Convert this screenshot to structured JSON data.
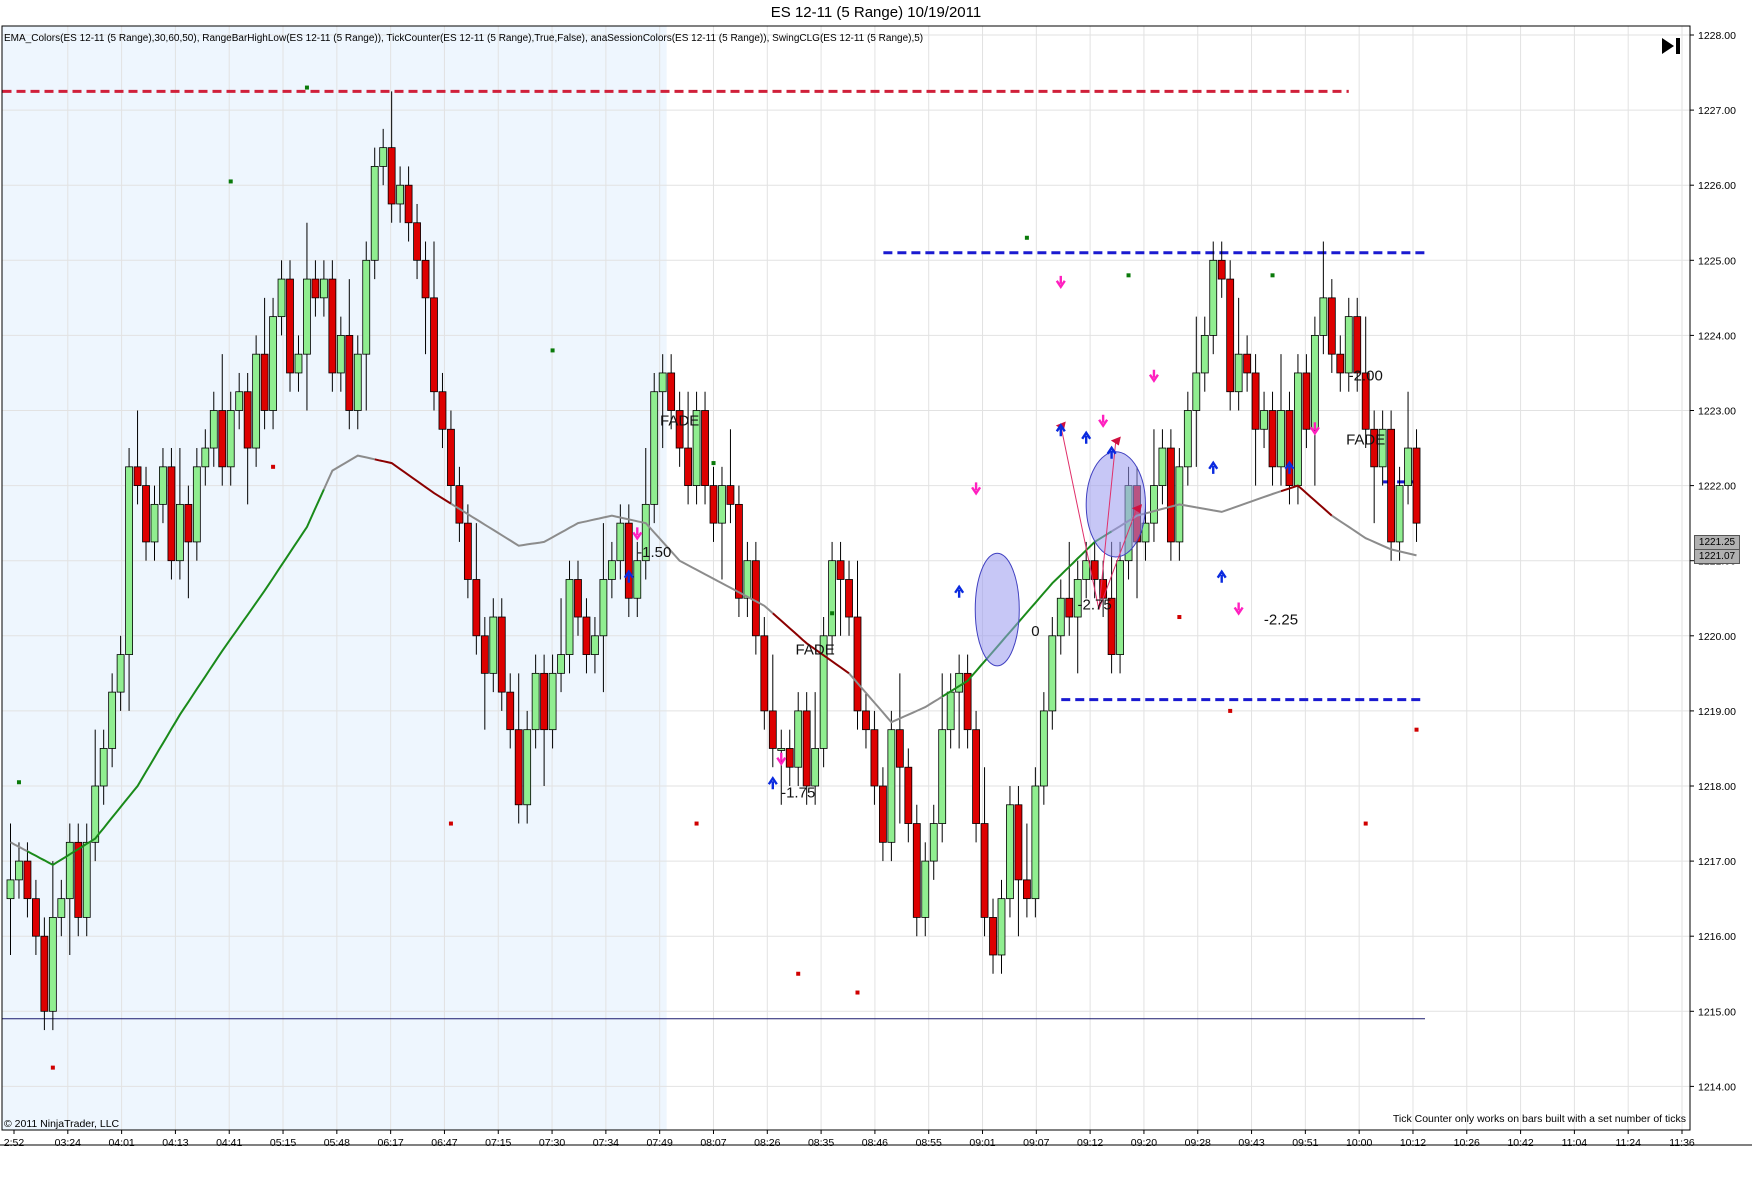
{
  "window": {
    "title": "ES 12-11 (5 Range)  10/19/2011",
    "indicators": "EMA_Colors(ES 12-11 (5 Range),30,60,50), RangeBarHighLow(ES 12-11 (5 Range)), TickCounter(ES 12-11 (5 Range),True,False), anaSessionColors(ES 12-11 (5 Range)), SwingCLG(ES 12-11 (5 Range),5)",
    "copyright": "© 2011 NinjaTrader, LLC",
    "tick_counter_note": "Tick Counter only works on bars built with a set number of ticks"
  },
  "colors": {
    "up_bar": "#90ee90",
    "down_bar": "#dd0000",
    "session_shade": "#eef6fe",
    "ema_up": "#1a8a1a",
    "ema_down": "#8b0000",
    "ema_flat": "#8c8c8c",
    "red_line": "#d0203a",
    "blue_line": "#1a1ad0",
    "circle_fill": "#9999ee"
  },
  "price_tags": [
    "1221.25",
    "1221.07"
  ],
  "chart_data": {
    "type": "candlestick",
    "title": "ES 12-11 (5 Range)  10/19/2011",
    "ylim": [
      1213.4,
      1228.2
    ],
    "y_ticks": [
      "1214.00",
      "1215.00",
      "1216.00",
      "1217.00",
      "1218.00",
      "1219.00",
      "1220.00",
      "1221.00",
      "1222.00",
      "1223.00",
      "1224.00",
      "1225.00",
      "1226.00",
      "1227.00",
      "1228.00"
    ],
    "x_ticks": [
      "2:52",
      "03:24",
      "04:01",
      "04:13",
      "04:41",
      "05:15",
      "05:48",
      "06:17",
      "06:47",
      "07:15",
      "07:30",
      "07:34",
      "07:49",
      "08:07",
      "08:26",
      "08:35",
      "08:46",
      "08:55",
      "09:01",
      "09:07",
      "09:12",
      "09:20",
      "09:28",
      "09:43",
      "09:51",
      "10:00",
      "10:12",
      "10:26",
      "10:42",
      "11:04",
      "11:24",
      "11:36"
    ],
    "bar_count": 167,
    "grid": true,
    "session_shading": {
      "from_bar": 0,
      "to_bar": 77
    },
    "opens": [
      1216.5,
      1216.75,
      1217.0,
      1216.5,
      1216.0,
      1215.0,
      1216.25,
      1216.5,
      1217.25,
      1216.25,
      1217.25,
      1218.0,
      1218.5,
      1219.25,
      1219.75,
      1222.25,
      1222.0,
      1221.25,
      1221.75,
      1222.25,
      1221.0,
      1221.75,
      1221.25,
      1222.25,
      1222.5,
      1223.0,
      1222.25,
      1223.0,
      1223.25,
      1222.5,
      1223.75,
      1223.0,
      1224.25,
      1224.75,
      1223.5,
      1223.75,
      1224.75,
      1224.5,
      1224.75,
      1223.5,
      1224.0,
      1223.0,
      1223.75,
      1225.0,
      1226.25,
      1226.5,
      1225.75,
      1226.0,
      1225.5,
      1225.0,
      1224.5,
      1223.25,
      1222.75,
      1222.0,
      1221.5,
      1220.75,
      1220.0,
      1219.5,
      1220.25,
      1219.25,
      1218.75,
      1217.75,
      1218.75,
      1219.5,
      1218.75,
      1219.5,
      1219.75,
      1220.75,
      1220.25,
      1219.75,
      1220.0,
      1220.75,
      1221.0,
      1221.5,
      1220.5,
      1221.0,
      1221.75,
      1223.25,
      1223.5,
      1223.0,
      1222.5,
      1222.0,
      1223.0,
      1222.0,
      1221.5,
      1222.0,
      1221.75,
      1220.5,
      1221.0,
      1220.0,
      1219.0,
      1218.5,
      1218.5,
      1218.25,
      1219.0,
      1218.0,
      1218.5,
      1220.0,
      1221.0,
      1220.75,
      1220.25,
      1219.0,
      1218.75,
      1218.0,
      1217.25,
      1218.75,
      1218.25,
      1217.5,
      1216.25,
      1217.0,
      1217.5,
      1218.75,
      1219.25,
      1219.5,
      1218.75,
      1217.5,
      1216.25,
      1215.75,
      1216.5,
      1217.75,
      1216.75,
      1216.5,
      1218.0,
      1219.0,
      1220.0,
      1220.5,
      1220.25,
      1220.75,
      1221.0,
      1220.75,
      1220.5,
      1219.75,
      1221.0,
      1222.0,
      1221.25,
      1221.5,
      1222.0,
      1222.5,
      1221.25,
      1222.25,
      1223.0,
      1223.5,
      1224.0,
      1225.0,
      1224.75,
      1223.25,
      1223.75,
      1223.5,
      1222.75,
      1223.0,
      1222.25,
      1223.0,
      1222.0,
      1223.5,
      1222.75,
      1224.0,
      1224.5,
      1223.75,
      1223.5,
      1224.25,
      1223.5,
      1222.75,
      1222.25,
      1222.75,
      1221.25,
      1222.0,
      1222.5,
      1221.5,
      1220.75
    ],
    "closes": [
      1216.75,
      1217.0,
      1216.5,
      1216.0,
      1215.0,
      1216.25,
      1216.5,
      1217.25,
      1216.25,
      1217.25,
      1218.0,
      1218.5,
      1219.25,
      1219.75,
      1222.25,
      1222.0,
      1221.25,
      1221.75,
      1222.25,
      1221.0,
      1221.75,
      1221.25,
      1222.25,
      1222.5,
      1223.0,
      1222.25,
      1223.0,
      1223.25,
      1222.5,
      1223.75,
      1223.0,
      1224.25,
      1224.75,
      1223.5,
      1223.75,
      1224.75,
      1224.5,
      1224.75,
      1223.5,
      1224.0,
      1223.0,
      1223.75,
      1225.0,
      1226.25,
      1226.5,
      1225.75,
      1226.0,
      1225.5,
      1225.0,
      1224.5,
      1223.25,
      1222.75,
      1222.0,
      1221.5,
      1220.75,
      1220.0,
      1219.5,
      1220.25,
      1219.25,
      1218.75,
      1217.75,
      1218.75,
      1219.5,
      1218.75,
      1219.5,
      1219.75,
      1220.75,
      1220.25,
      1219.75,
      1220.0,
      1220.75,
      1221.0,
      1221.5,
      1220.5,
      1221.0,
      1221.75,
      1223.25,
      1223.5,
      1223.0,
      1222.5,
      1222.0,
      1223.0,
      1222.0,
      1221.5,
      1222.0,
      1221.75,
      1220.5,
      1221.0,
      1220.0,
      1219.0,
      1218.5,
      1218.5,
      1218.25,
      1219.0,
      1218.0,
      1218.5,
      1220.0,
      1221.0,
      1220.75,
      1220.25,
      1219.0,
      1218.75,
      1218.0,
      1217.25,
      1218.75,
      1218.25,
      1217.5,
      1216.25,
      1217.0,
      1217.5,
      1218.75,
      1219.25,
      1219.5,
      1218.75,
      1217.5,
      1216.25,
      1215.75,
      1216.5,
      1217.75,
      1216.75,
      1216.5,
      1218.0,
      1219.0,
      1220.0,
      1220.5,
      1220.25,
      1220.75,
      1221.0,
      1220.75,
      1220.5,
      1219.75,
      1221.0,
      1222.0,
      1221.25,
      1221.5,
      1222.0,
      1222.5,
      1221.25,
      1222.25,
      1223.0,
      1223.5,
      1224.0,
      1225.0,
      1224.75,
      1223.25,
      1223.75,
      1223.5,
      1222.75,
      1223.0,
      1222.25,
      1223.0,
      1222.0,
      1223.5,
      1222.75,
      1224.0,
      1224.5,
      1223.75,
      1223.5,
      1224.25,
      1223.5,
      1222.75,
      1222.25,
      1222.75,
      1221.25,
      1222.0,
      1222.5,
      1221.5,
      1220.75,
      1221.07
    ],
    "swing_high_marks": [
      {
        "bar": 1,
        "price": 1218.05
      },
      {
        "bar": 26,
        "price": 1226.05
      },
      {
        "bar": 35,
        "price": 1227.3
      },
      {
        "bar": 64,
        "price": 1223.8
      },
      {
        "bar": 83,
        "price": 1222.3
      },
      {
        "bar": 97,
        "price": 1220.3
      },
      {
        "bar": 120,
        "price": 1225.3
      },
      {
        "bar": 132,
        "price": 1224.8
      },
      {
        "bar": 149,
        "price": 1224.8
      }
    ],
    "swing_low_marks": [
      {
        "bar": 5,
        "price": 1214.25
      },
      {
        "bar": 31,
        "price": 1222.25
      },
      {
        "bar": 52,
        "price": 1217.5
      },
      {
        "bar": 81,
        "price": 1217.5
      },
      {
        "bar": 93,
        "price": 1215.5
      },
      {
        "bar": 100,
        "price": 1215.25
      },
      {
        "bar": 138,
        "price": 1220.25
      },
      {
        "bar": 144,
        "price": 1219.0
      },
      {
        "bar": 160,
        "price": 1217.5
      },
      {
        "bar": 166,
        "price": 1218.75
      }
    ],
    "ema": [
      {
        "bar": 0,
        "price": 1217.25
      },
      {
        "bar": 5,
        "price": 1216.95
      },
      {
        "bar": 10,
        "price": 1217.3
      },
      {
        "bar": 15,
        "price": 1218.0
      },
      {
        "bar": 20,
        "price": 1218.95
      },
      {
        "bar": 25,
        "price": 1219.8
      },
      {
        "bar": 30,
        "price": 1220.6
      },
      {
        "bar": 35,
        "price": 1221.45
      },
      {
        "bar": 38,
        "price": 1222.2
      },
      {
        "bar": 41,
        "price": 1222.4
      },
      {
        "bar": 45,
        "price": 1222.3
      },
      {
        "bar": 50,
        "price": 1221.9
      },
      {
        "bar": 55,
        "price": 1221.55
      },
      {
        "bar": 60,
        "price": 1221.2
      },
      {
        "bar": 63,
        "price": 1221.25
      },
      {
        "bar": 67,
        "price": 1221.5
      },
      {
        "bar": 71,
        "price": 1221.6
      },
      {
        "bar": 75,
        "price": 1221.5
      },
      {
        "bar": 79,
        "price": 1221.0
      },
      {
        "bar": 84,
        "price": 1220.7
      },
      {
        "bar": 89,
        "price": 1220.4
      },
      {
        "bar": 94,
        "price": 1219.9
      },
      {
        "bar": 99,
        "price": 1219.5
      },
      {
        "bar": 104,
        "price": 1218.85
      },
      {
        "bar": 108,
        "price": 1219.05
      },
      {
        "bar": 113,
        "price": 1219.4
      },
      {
        "bar": 118,
        "price": 1220.05
      },
      {
        "bar": 123,
        "price": 1220.7
      },
      {
        "bar": 128,
        "price": 1221.25
      },
      {
        "bar": 133,
        "price": 1221.6
      },
      {
        "bar": 138,
        "price": 1221.75
      },
      {
        "bar": 143,
        "price": 1221.65
      },
      {
        "bar": 148,
        "price": 1221.85
      },
      {
        "bar": 152,
        "price": 1222.0
      },
      {
        "bar": 156,
        "price": 1221.6
      },
      {
        "bar": 160,
        "price": 1221.3
      },
      {
        "bar": 163,
        "price": 1221.15
      },
      {
        "bar": 166,
        "price": 1221.07
      }
    ],
    "ema_color_segments": [
      {
        "from_bar": 0,
        "to_bar": 2,
        "color": "flat"
      },
      {
        "from_bar": 2,
        "to_bar": 37,
        "color": "up"
      },
      {
        "from_bar": 37,
        "to_bar": 43,
        "color": "flat"
      },
      {
        "from_bar": 43,
        "to_bar": 52,
        "color": "down"
      },
      {
        "from_bar": 52,
        "to_bar": 90,
        "color": "flat"
      },
      {
        "from_bar": 90,
        "to_bar": 99,
        "color": "down"
      },
      {
        "from_bar": 99,
        "to_bar": 110,
        "color": "flat"
      },
      {
        "from_bar": 110,
        "to_bar": 130,
        "color": "up"
      },
      {
        "from_bar": 130,
        "to_bar": 150,
        "color": "flat"
      },
      {
        "from_bar": 150,
        "to_bar": 156,
        "color": "down"
      },
      {
        "from_bar": 156,
        "to_bar": 166,
        "color": "flat"
      }
    ],
    "horizontal_lines": [
      {
        "price": 1227.25,
        "from_bar": 0,
        "to_bar": 158,
        "color": "red",
        "style": "dashed"
      },
      {
        "price": 1225.1,
        "from_bar": 104,
        "to_bar": 167,
        "color": "blue",
        "style": "dashed"
      },
      {
        "price": 1219.15,
        "from_bar": 125,
        "to_bar": 167,
        "color": "blue",
        "style": "dashed"
      },
      {
        "price": 1222.05,
        "from_bar": 163,
        "to_bar": 167,
        "color": "blue",
        "style": "dashed"
      },
      {
        "price": 1214.9,
        "from_bar": 0,
        "to_bar": 167,
        "color": "navy",
        "style": "solid"
      }
    ],
    "annotations": [
      {
        "text": "FADE",
        "bar": 79,
        "price": 1222.8
      },
      {
        "text": "-1.50",
        "bar": 76,
        "price": 1221.05
      },
      {
        "text": "FADE",
        "bar": 95,
        "price": 1219.75
      },
      {
        "text": "-1.75",
        "bar": 93,
        "price": 1217.85
      },
      {
        "text": "0",
        "bar": 121,
        "price": 1220.0
      },
      {
        "text": "-2.75",
        "bar": 128,
        "price": 1220.35
      },
      {
        "text": "-2.25",
        "bar": 150,
        "price": 1220.15
      },
      {
        "text": "-2.00",
        "bar": 160,
        "price": 1223.4
      },
      {
        "text": "FADE",
        "bar": 160,
        "price": 1222.55
      }
    ],
    "highlight_ellipses": [
      {
        "bar": 116.5,
        "price": 1220.35,
        "rx_bars": 2.6,
        "ry_price": 0.75
      },
      {
        "bar": 130.5,
        "price": 1221.75,
        "rx_bars": 3.5,
        "ry_price": 0.7
      }
    ],
    "pointer_lines": [
      {
        "from": {
          "bar": 128.5,
          "price": 1220.35
        },
        "to": {
          "bar": 124,
          "price": 1222.8
        }
      },
      {
        "from": {
          "bar": 128.5,
          "price": 1220.35
        },
        "to": {
          "bar": 130.5,
          "price": 1222.6
        }
      },
      {
        "from": {
          "bar": 128.5,
          "price": 1220.35
        },
        "to": {
          "bar": 133,
          "price": 1221.7
        }
      }
    ],
    "down_arrows": [
      {
        "bar": 74,
        "price": 1221.35
      },
      {
        "bar": 114,
        "price": 1221.95
      },
      {
        "bar": 124,
        "price": 1224.7
      },
      {
        "bar": 129,
        "price": 1222.85
      },
      {
        "bar": 135,
        "price": 1223.45
      },
      {
        "bar": 145,
        "price": 1220.35
      },
      {
        "bar": 154,
        "price": 1222.75
      },
      {
        "bar": 91,
        "price": 1218.35
      }
    ],
    "up_arrows": [
      {
        "bar": 73,
        "price": 1220.8
      },
      {
        "bar": 112,
        "price": 1220.6
      },
      {
        "bar": 124,
        "price": 1222.75
      },
      {
        "bar": 127,
        "price": 1222.65
      },
      {
        "bar": 130,
        "price": 1222.45
      },
      {
        "bar": 143,
        "price": 1220.8
      },
      {
        "bar": 151,
        "price": 1222.25
      },
      {
        "bar": 90,
        "price": 1218.05
      },
      {
        "bar": 142,
        "price": 1222.25
      }
    ]
  }
}
